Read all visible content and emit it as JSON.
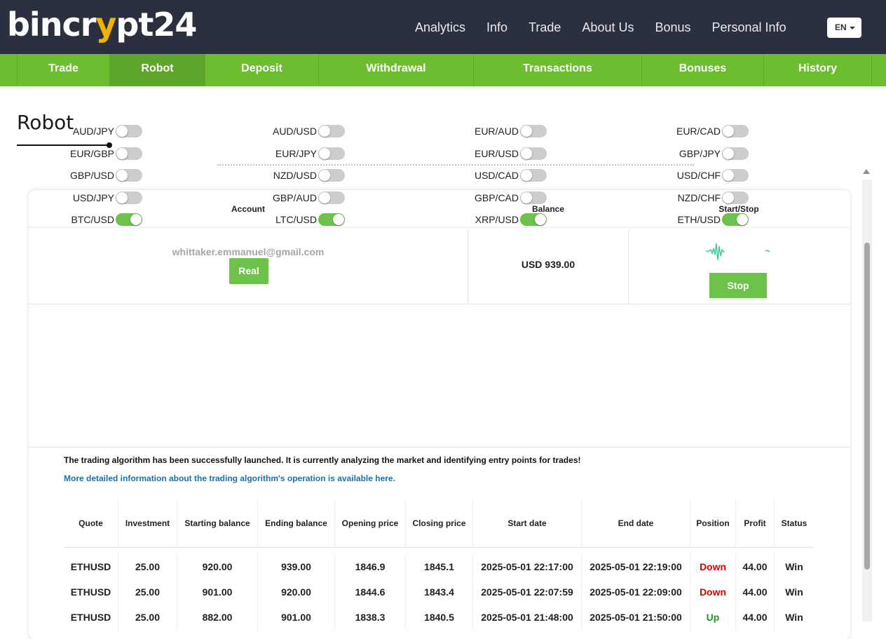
{
  "brand": {
    "logo_pre": "bincr",
    "logo_mid": "y",
    "logo_post": "pt24"
  },
  "topnav": [
    "Analytics",
    "Info",
    "Trade",
    "About Us",
    "Bonus",
    "Personal Info"
  ],
  "language": "EN",
  "tabs": [
    {
      "label": "Trade",
      "active": false
    },
    {
      "label": "Robot",
      "active": true
    },
    {
      "label": "Deposit",
      "active": false
    },
    {
      "label": "Withdrawal",
      "active": false
    },
    {
      "label": "Transactions",
      "active": false
    },
    {
      "label": "Bonuses",
      "active": false
    },
    {
      "label": "History",
      "active": false
    }
  ],
  "page_title": "Robot",
  "card": {
    "headers": {
      "account": "Account",
      "balance": "Balance",
      "start_stop": "Start/Stop"
    },
    "email": "whittaker.emmanuel@gmail.com",
    "real_label": "Real",
    "balance_value": "USD 939.00",
    "stop_label": "Stop"
  },
  "pairs": [
    [
      "AUD/JPY",
      "AUD/USD",
      "EUR/AUD",
      "EUR/CAD"
    ],
    [
      "EUR/GBP",
      "EUR/JPY",
      "EUR/USD",
      "GBP/JPY"
    ],
    [
      "GBP/USD",
      "NZD/USD",
      "USD/CAD",
      "USD/CHF"
    ],
    [
      "USD/JPY",
      "GBP/AUD",
      "GBP/CAD",
      "NZD/CHF"
    ],
    [
      "BTC/USD",
      "LTC/USD",
      "XRP/USD",
      "ETH/USD"
    ]
  ],
  "pairs_enabled": [
    "BTC/USD",
    "LTC/USD",
    "XRP/USD",
    "ETH/USD"
  ],
  "message": "The trading algorithm has been successfully launched. It is currently analyzing the market and identifying entry points for trades!",
  "more_info_link": "More detailed information about the trading algorithm's operation is available here.",
  "results": {
    "columns": [
      "Quote",
      "Investment",
      "Starting balance",
      "Ending balance",
      "Opening price",
      "Closing price",
      "Start date",
      "End date",
      "Position",
      "Profit",
      "Status"
    ],
    "rows": [
      [
        "ETHUSD",
        "25.00",
        "920.00",
        "939.00",
        "1846.9",
        "1845.1",
        "2025-05-01 22:17:00",
        "2025-05-01 22:19:00",
        "Down",
        "44.00",
        "Win"
      ],
      [
        "ETHUSD",
        "25.00",
        "901.00",
        "920.00",
        "1844.6",
        "1843.4",
        "2025-05-01 22:07:59",
        "2025-05-01 22:09:00",
        "Down",
        "44.00",
        "Win"
      ],
      [
        "ETHUSD",
        "25.00",
        "882.00",
        "901.00",
        "1838.3",
        "1840.5",
        "2025-05-01 21:48:00",
        "2025-05-01 21:50:00",
        "Up",
        "44.00",
        "Win"
      ]
    ]
  },
  "colors": {
    "navbar": "#2b3040",
    "tabbar": "#6cbd2f",
    "button_green": "#6cc24a",
    "down": "#e00000",
    "up": "#1a9a1a",
    "link": "#1a73a8"
  }
}
